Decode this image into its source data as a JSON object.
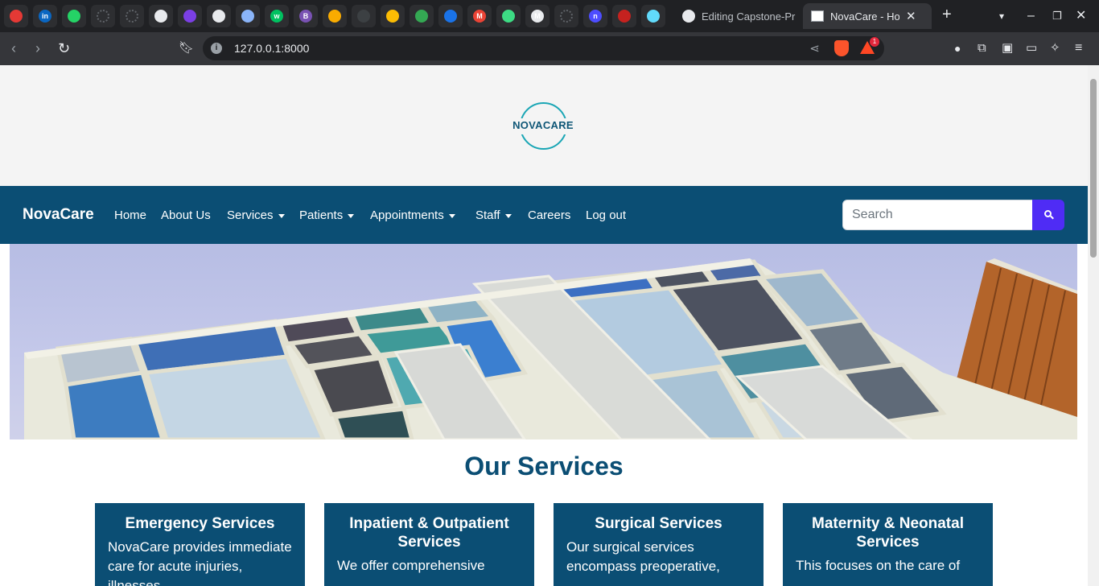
{
  "browser": {
    "pinned_tabs": [
      {
        "icon": "red-circle-g-icon",
        "label": "",
        "color": "#e53935"
      },
      {
        "icon": "linkedin-icon",
        "label": "in",
        "color": "#0a66c2"
      },
      {
        "icon": "whatsapp-icon",
        "label": "",
        "color": "#25d366"
      },
      {
        "icon": "loading-icon",
        "label": "",
        "color": "#5f6368"
      },
      {
        "icon": "loading-icon",
        "label": "",
        "color": "#5f6368"
      },
      {
        "icon": "github-icon",
        "label": "",
        "color": "#e8eaed"
      },
      {
        "icon": "vercel-icon",
        "label": "",
        "color": "#7b3fe4"
      },
      {
        "icon": "chatgpt-icon",
        "label": "",
        "color": "#e8eaed"
      },
      {
        "icon": "gemini-icon",
        "label": "",
        "color": "#8ab4f8"
      },
      {
        "icon": "wellfound-icon",
        "label": "w",
        "color": "#00c160"
      },
      {
        "icon": "bootstrap-icon",
        "label": "B",
        "color": "#7952b3"
      },
      {
        "icon": "colorwheel-icon",
        "label": "",
        "color": "#f9ab00"
      },
      {
        "icon": "dark-icon",
        "label": "",
        "color": "#3c4043"
      },
      {
        "icon": "drive-icon",
        "label": "",
        "color": "#fbbc04"
      },
      {
        "icon": "drive-icon",
        "label": "",
        "color": "#34a853"
      },
      {
        "icon": "globe-icon",
        "label": "",
        "color": "#1a73e8"
      },
      {
        "icon": "gmail-icon",
        "label": "M",
        "color": "#ea4335"
      },
      {
        "icon": "android-icon",
        "label": "",
        "color": "#3ddc84"
      },
      {
        "icon": "medium-icon",
        "label": "M",
        "color": "#e8eaed"
      },
      {
        "icon": "loading-icon",
        "label": "",
        "color": "#5f6368"
      },
      {
        "icon": "notion-icon",
        "label": "n",
        "color": "#4d4dff"
      },
      {
        "icon": "red-app-icon",
        "label": "",
        "color": "#c5221f"
      },
      {
        "icon": "react-icon",
        "label": "",
        "color": "#61dafb"
      }
    ],
    "tabs": [
      {
        "title": "Editing Capstone-Pr",
        "icon": "github-icon"
      },
      {
        "title": "NovaCare - Home",
        "icon": "page-icon"
      }
    ],
    "url": "127.0.0.1:8000",
    "shields_badge": "1"
  },
  "page": {
    "logo_text": "NOVACARE",
    "brand": "NovaCare",
    "nav": [
      {
        "label": "Home",
        "dropdown": false
      },
      {
        "label": "About Us",
        "dropdown": false
      },
      {
        "label": "Services",
        "dropdown": true
      },
      {
        "label": "Patients",
        "dropdown": true
      },
      {
        "label": "Appointments",
        "dropdown": true
      },
      {
        "label": "Staff",
        "dropdown": true
      },
      {
        "label": "Careers",
        "dropdown": false
      },
      {
        "label": "Log out",
        "dropdown": false
      }
    ],
    "search": {
      "placeholder": "Search"
    },
    "section_title": "Our Services",
    "cards": [
      {
        "title": "Emergency Services",
        "text": "NovaCare provides immediate care for acute injuries, illnesses,"
      },
      {
        "title": "Inpatient & Outpatient Services",
        "text": "We offer comprehensive"
      },
      {
        "title": "Surgical Services",
        "text": "Our surgical services encompass preoperative,"
      },
      {
        "title": "Maternity & Neonatal Services",
        "text": "This focuses on the care of"
      }
    ],
    "colors": {
      "nav_bg": "#0b4e74",
      "accent": "#4f2cf5",
      "logo_ring": "#1aa6b5"
    }
  }
}
